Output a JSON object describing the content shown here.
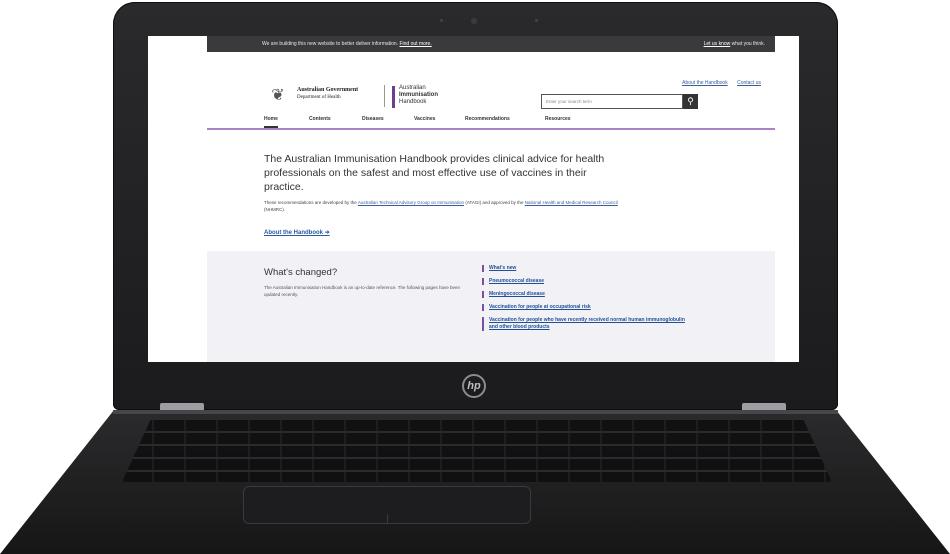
{
  "device": {
    "brand_logo": "hp"
  },
  "site": {
    "notice": {
      "text": "We are building this new website to better deliver information.",
      "link": "Find out more.",
      "feedback_link": "Let us know",
      "feedback_text": "what you think."
    },
    "header": {
      "gov_line1": "Australian Government",
      "gov_line2": "Department of Health",
      "handbook_line1": "Australian",
      "handbook_line2": "Immunisation",
      "handbook_line3": "Handbook",
      "top_links": [
        "About the Handbook",
        "Contact us"
      ],
      "search_placeholder": "Enter your search term",
      "search_icon": "search-icon"
    },
    "nav": [
      "Home",
      "Contents",
      "Diseases",
      "Vaccines",
      "Recommendations",
      "Resources"
    ],
    "intro": {
      "heading": "The Australian Immunisation Handbook provides clinical advice for health professionals on the safest and most effective use of vaccines in their practice.",
      "text_a": "These recommendations are developed by the",
      "link_a": "Australian Technical Advisory Group on Immunisation",
      "text_b": "(ATAGI) and approved by the",
      "link_b": "National Health and Medical Research Council",
      "text_c": "(NHMRC).",
      "about_link": "About the Handbook ➔"
    },
    "changed": {
      "title": "What's changed?",
      "description": "The Australian Immunisation Handbook is an up-to-date reference. The following pages have been updated recently.",
      "links": [
        "What's new",
        "Pneumococcal disease",
        "Meningococcal disease",
        "Vaccination for people at occupational risk",
        "Vaccination for people who have recently received normal human immunoglobulin and other blood products"
      ]
    }
  }
}
